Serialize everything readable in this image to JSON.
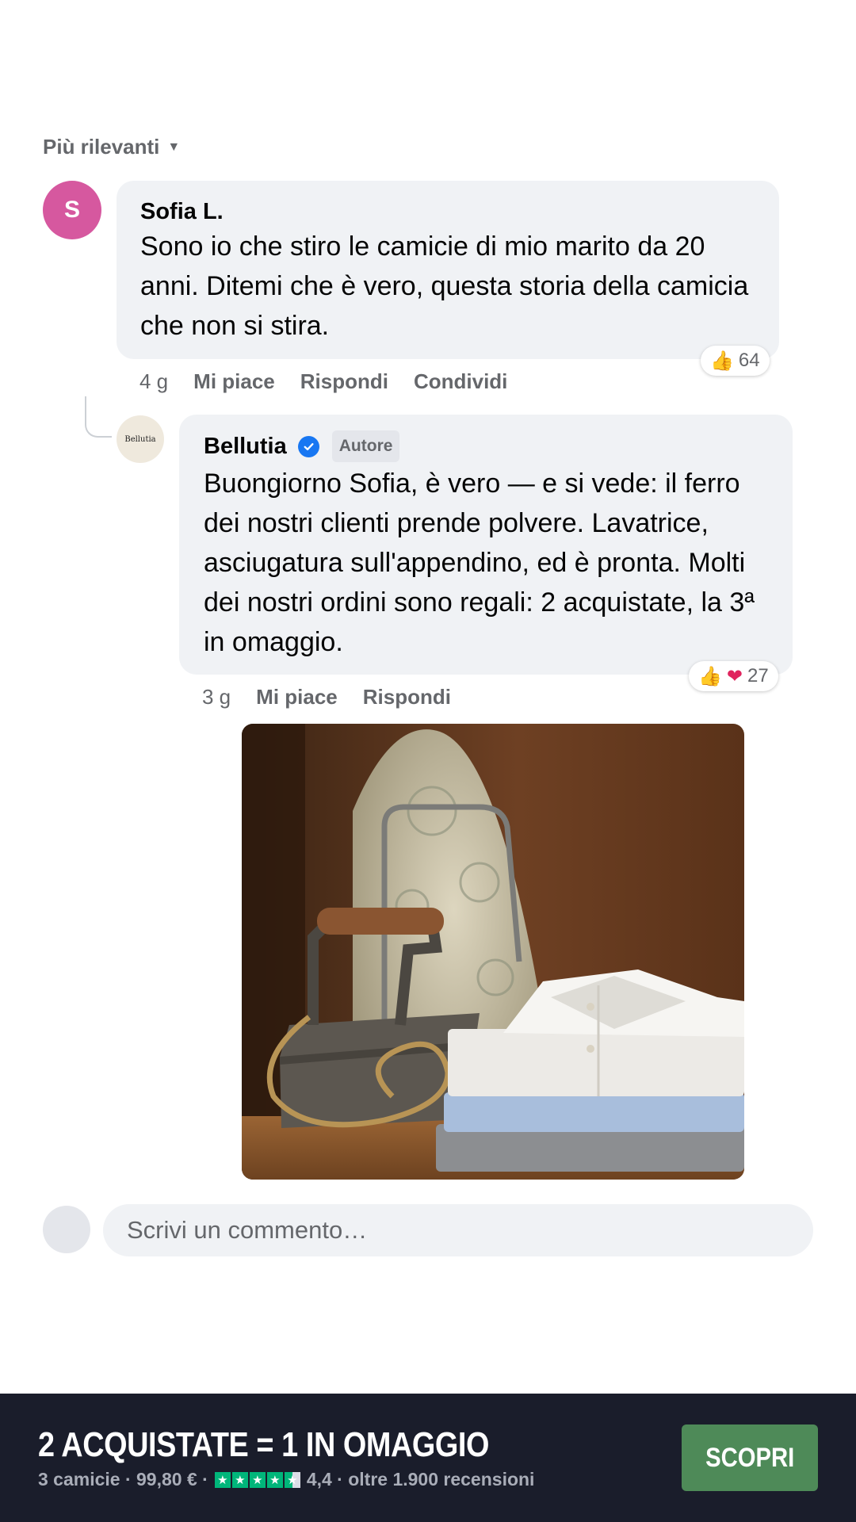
{
  "sort": {
    "label": "Più rilevanti",
    "caret": "▼"
  },
  "comments": [
    {
      "avatar_initial": "S",
      "author": "Sofia L.",
      "text": "Sono io che stiro le camicie di mio marito da 20 anni. Ditemi che è vero, questa storia della camicia che non si stira.",
      "reactions": {
        "icons": [
          "like-icon"
        ],
        "count": "64"
      },
      "time": "4 g",
      "actions": [
        "Mi piace",
        "Rispondi",
        "Condividi"
      ],
      "avatar_color": "#d6589f"
    }
  ],
  "reply": {
    "avatar_logo_text": "Bellutia",
    "author": "Bellutia",
    "verified": true,
    "author_badge": "Autore",
    "text": "Buongiorno Sofia, è vero — e si vede: il ferro dei nostri clienti prende polvere. Lavatrice, asciugatura sull'appendino, ed è pronta. Molti dei nostri ordini sono regali: 2 acquistate, la 3ª in omaggio.",
    "reactions": {
      "icons": [
        "like-icon",
        "heart-icon"
      ],
      "count": "27"
    },
    "time": "3 g",
    "actions": [
      "Mi piace",
      "Rispondi"
    ]
  },
  "composer": {
    "placeholder": "Scrivi un commento…"
  },
  "promo": {
    "title": "2 ACQUISTATE = 1 IN OMAGGIO",
    "price_line": "3 camicie · 99,80 € ·",
    "rating_line": "4,4 · oltre 1.900 recensioni",
    "stars": 4.5,
    "cta_label": "SCOPRI",
    "colors": {
      "background": "#1a1d2b",
      "cta": "#4e8a58",
      "stars": "#00b67a"
    }
  }
}
